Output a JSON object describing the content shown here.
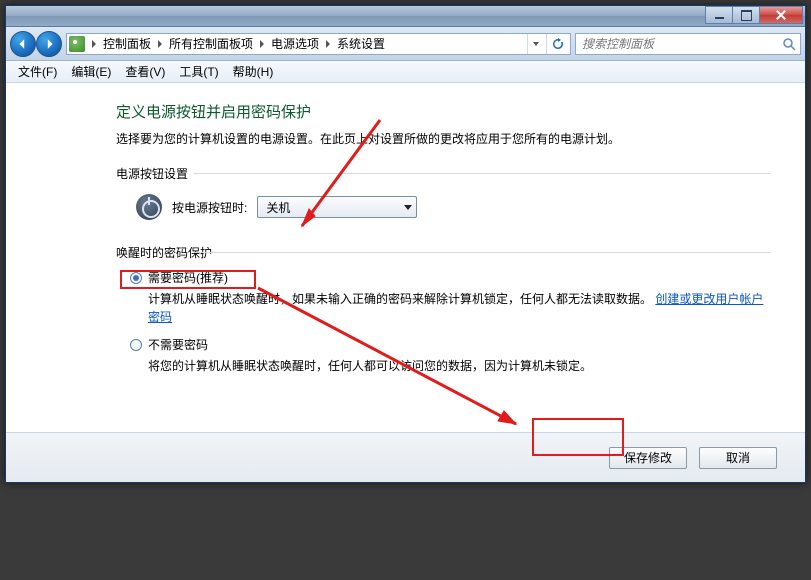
{
  "breadcrumb": {
    "items": [
      "控制面板",
      "所有控制面板项",
      "电源选项",
      "系统设置"
    ]
  },
  "search": {
    "placeholder": "搜索控制面板"
  },
  "menu": {
    "file": "文件(F)",
    "edit": "编辑(E)",
    "view": "查看(V)",
    "tools": "工具(T)",
    "help": "帮助(H)"
  },
  "page": {
    "title": "定义电源按钮并启用密码保护",
    "subtitle": "选择要为您的计算机设置的电源设置。在此页上对设置所做的更改将应用于您所有的电源计划。"
  },
  "power_button": {
    "section_label": "电源按钮设置",
    "row_label": "按电源按钮时:",
    "selected": "关机"
  },
  "wake_protect": {
    "section_label": "唤醒时的密码保护",
    "option1_label": "需要密码(推荐)",
    "option1_desc_pre": "计算机从睡眠状态唤醒时，如果未输入正确的密码来解除计算机锁定，任何人都无法读取数据。",
    "option1_link": "创建或更改用户帐户密码",
    "option2_label": "不需要密码",
    "option2_desc": "将您的计算机从睡眠状态唤醒时，任何人都可以访问您的数据，因为计算机未锁定。"
  },
  "buttons": {
    "save": "保存修改",
    "cancel": "取消"
  }
}
